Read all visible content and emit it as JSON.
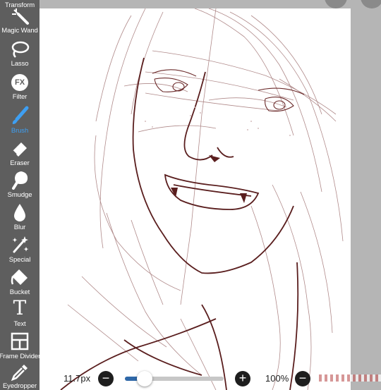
{
  "toolbar": {
    "tools": [
      {
        "label": "Transform",
        "icon": "transform-icon"
      },
      {
        "label": "Magic Wand",
        "icon": "magic-wand-icon"
      },
      {
        "label": "Lasso",
        "icon": "lasso-icon"
      },
      {
        "label": "Filter",
        "icon": "filter-icon"
      },
      {
        "label": "Brush",
        "icon": "brush-icon",
        "active": true
      },
      {
        "label": "Eraser",
        "icon": "eraser-icon"
      },
      {
        "label": "Smudge",
        "icon": "smudge-icon"
      },
      {
        "label": "Blur",
        "icon": "blur-icon"
      },
      {
        "label": "Special",
        "icon": "special-icon"
      },
      {
        "label": "Bucket",
        "icon": "bucket-icon"
      },
      {
        "label": "Text",
        "icon": "text-icon"
      },
      {
        "label": "Frame Divider",
        "icon": "frame-divider-icon"
      },
      {
        "label": "Eyedropper",
        "icon": "eyedropper-icon"
      }
    ],
    "filter_glyph": "FX",
    "text_glyph": "T"
  },
  "bottom_bar": {
    "brush_size": "11.7px",
    "size_slider_fraction": 0.2,
    "opacity": "100%",
    "minus_glyph": "−",
    "plus_glyph": "+"
  },
  "colors": {
    "toolbar_bg": "#5e5e5e",
    "active_tool": "#3e9ff2",
    "canvas_bg": "#b5b5b5",
    "paper": "#ffffff",
    "line_art": "#5a1e1e",
    "slider_fill": "#2f68a8"
  }
}
